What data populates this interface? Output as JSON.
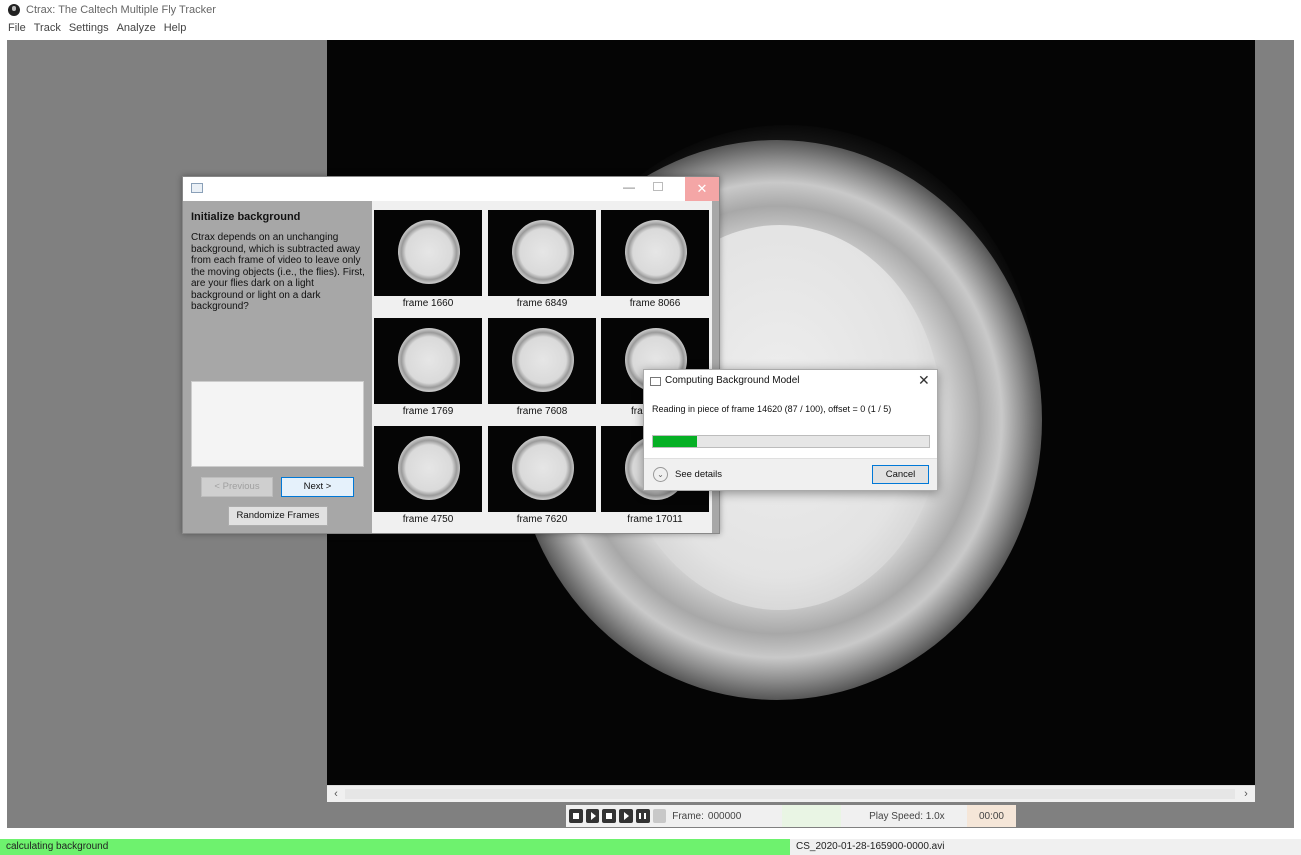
{
  "app": {
    "title": "Ctrax: The Caltech Multiple Fly Tracker",
    "icon": "ctrax-fly-icon"
  },
  "menu": [
    "File",
    "Track",
    "Settings",
    "Analyze",
    "Help"
  ],
  "init_dialog": {
    "heading": "Initialize background",
    "description": "Ctrax depends on an unchanging background, which is subtracted away from each frame of video to leave only the moving objects (i.e., the flies). First, are your flies dark on a light background or light on a dark background?",
    "textbox_value": "",
    "prev_label": "< Previous",
    "next_label": "Next >",
    "randomize_label": "Randomize Frames",
    "frames": [
      "frame 1660",
      "frame 6849",
      "frame 8066",
      "frame 1769",
      "frame 7608",
      "fram",
      "frame 4750",
      "frame 7620",
      "frame 17011"
    ]
  },
  "progress_dialog": {
    "title": "Computing Background Model",
    "message": "Reading in piece of frame 14620 (87 / 100), offset = 0 (1 / 5)",
    "progress_fraction": 0.16,
    "details_label": "See details",
    "cancel_label": "Cancel",
    "close_glyph": "✕",
    "details_glyph": "⌄"
  },
  "controls": {
    "frame_label": "Frame:",
    "frame_value": "000000",
    "speed_label": "Play Speed: 1.0x",
    "time": "00:00"
  },
  "scroll": {
    "left": "‹",
    "right": "›"
  },
  "status": {
    "message": "calculating background",
    "filename": "CS_2020-01-28-165900-0000.avi",
    "color": "#6ef26e"
  }
}
